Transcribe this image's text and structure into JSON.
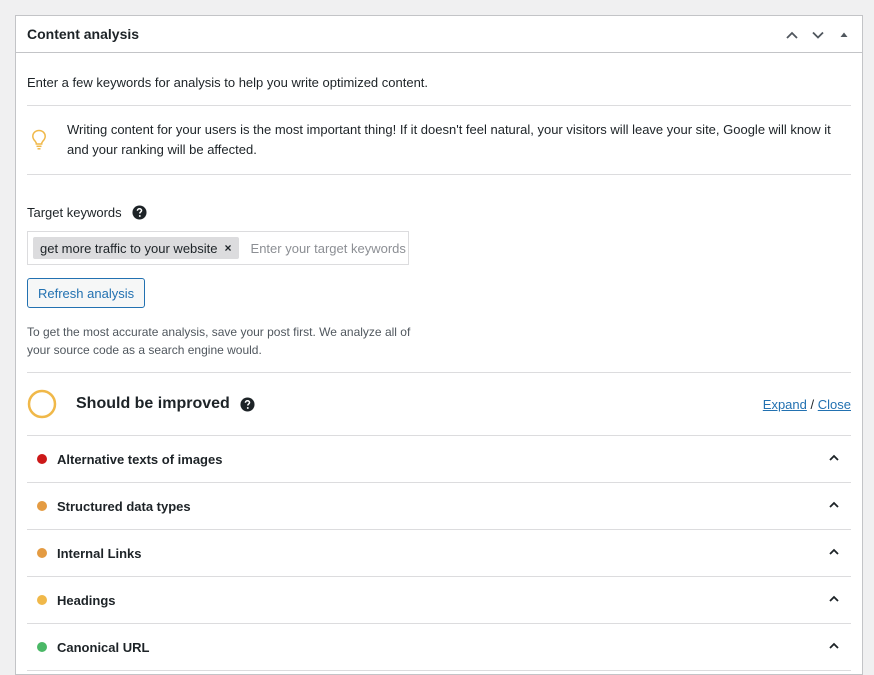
{
  "panel": {
    "title": "Content analysis",
    "controls": {
      "move_up_icon": "chevron-up-icon",
      "move_down_icon": "chevron-down-icon",
      "toggle_icon": "triangle-up-icon"
    }
  },
  "intro": "Enter a few keywords for analysis to help you write optimized content.",
  "tip": {
    "icon": "lightbulb-icon",
    "text": "Writing content for your users is the most important thing! If it doesn't feel natural, your visitors will leave your site, Google will know it and your ranking will be affected."
  },
  "keywords": {
    "label": "Target keywords",
    "help_icon": "question-circle-icon",
    "tags": [
      {
        "text": "get more traffic to your website",
        "remove": "×"
      }
    ],
    "placeholder": "Enter your target keywords",
    "value": ""
  },
  "refresh_button": "Refresh analysis",
  "note": "To get the most accurate analysis, save your post first. We analyze all of your source code as a search engine would.",
  "summary": {
    "title": "Should be improved",
    "help_icon": "question-circle-icon",
    "expand": "Expand",
    "separator": "/",
    "close": "Close"
  },
  "colors": {
    "accent": "#2271b1",
    "ring": "#f0b849",
    "red": "#cc1818",
    "orange": "#e49b42",
    "yellow": "#f0b849",
    "green": "#4ab866"
  },
  "items": [
    {
      "label": "Alternative texts of images",
      "status": "red"
    },
    {
      "label": "Structured data types",
      "status": "orange"
    },
    {
      "label": "Internal Links",
      "status": "orange"
    },
    {
      "label": "Headings",
      "status": "yellow"
    },
    {
      "label": "Canonical URL",
      "status": "green"
    }
  ]
}
